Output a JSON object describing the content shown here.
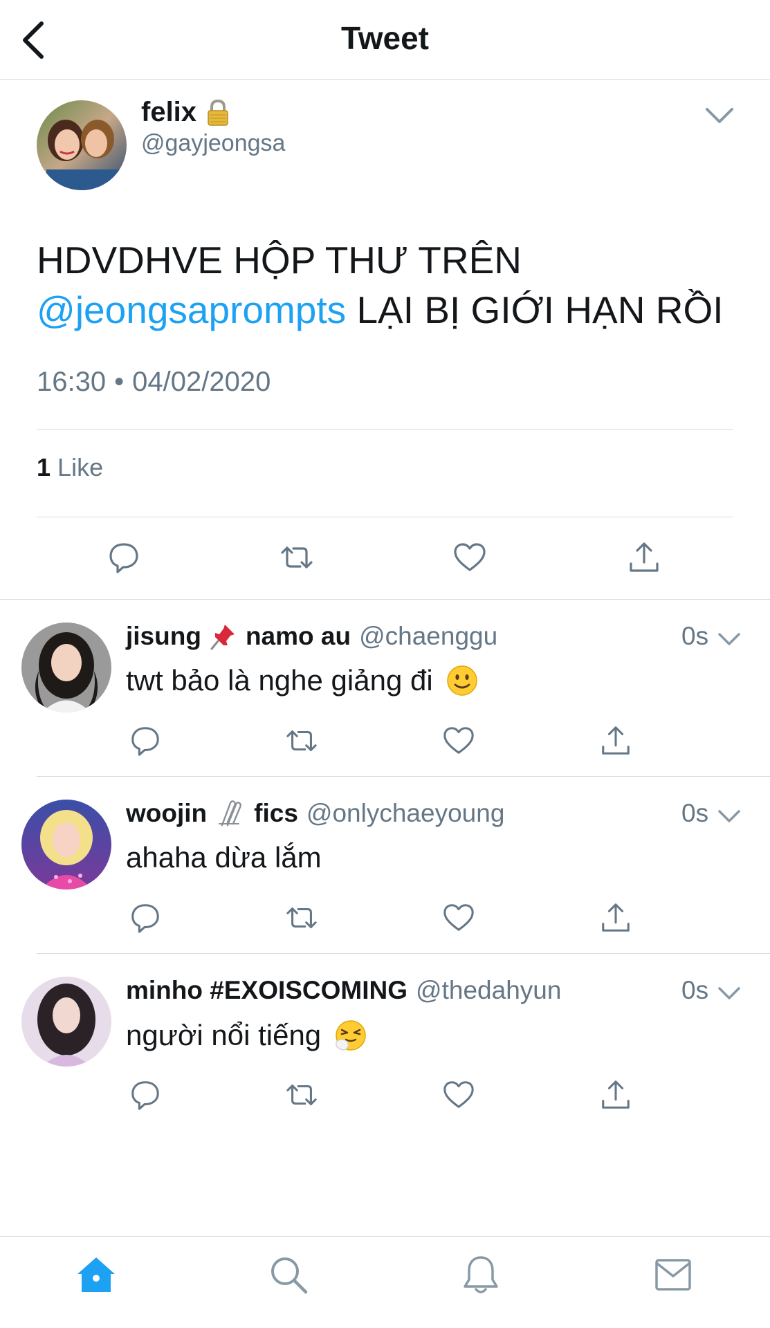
{
  "header": {
    "title": "Tweet"
  },
  "main_tweet": {
    "name": "felix",
    "handle": "@gayjeongsa",
    "text_part1": "HDVDHVE HỘP THƯ TRÊN",
    "mention": "@jeongsaprompts",
    "text_part2": "LẠI BỊ GIỚI HẠN RỒI",
    "time": "16:30",
    "separator": "•",
    "date": "04/02/2020",
    "likes_count": "1",
    "likes_label": "Like"
  },
  "replies": [
    {
      "name": "jisung",
      "emoji": "📌",
      "name2": "namo au",
      "handle": "@chaenggu",
      "time": "0s",
      "text": "twt bảo là nghe giảng đi"
    },
    {
      "name": "woojin",
      "emoji": "📎",
      "name2": "fics",
      "handle": "@onlychaeyoung",
      "time": "0s",
      "text": "ahaha dừa lắm"
    },
    {
      "name": "minho #EXOISCOMING",
      "emoji": "",
      "name2": "",
      "handle": "@thedahyun",
      "time": "0s",
      "text": "người nổi tiếng"
    }
  ],
  "icons": {
    "back": "chevron-left-icon",
    "lock": "lock-icon",
    "caret": "chevron-down-icon",
    "reply": "reply-icon",
    "retweet": "retweet-icon",
    "like": "heart-icon",
    "share": "share-icon",
    "home": "home-icon",
    "search": "search-icon",
    "notifications": "bell-icon",
    "messages": "mail-icon"
  },
  "colors": {
    "accent": "#1da1f2",
    "secondary_text": "#657786",
    "primary_text": "#14171a",
    "divider": "#d5dbe0"
  },
  "tabbar": {
    "active": "home"
  }
}
